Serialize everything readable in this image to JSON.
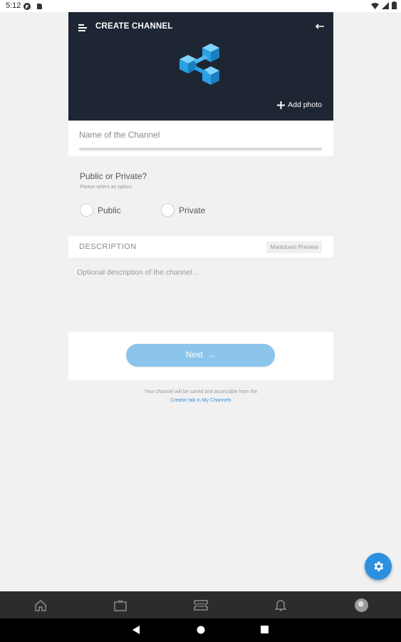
{
  "status_bar": {
    "time": "5:12"
  },
  "header": {
    "title": "CREATE CHANNEL",
    "add_photo_label": "Add photo"
  },
  "name_field": {
    "placeholder": "Name of the Channel",
    "value": ""
  },
  "privacy": {
    "title": "Public or Private?",
    "hint": "Please select an option.",
    "options": [
      "Public",
      "Private"
    ],
    "selected": null
  },
  "description": {
    "label": "DESCRIPTION",
    "markdown_preview_label": "Markdown Preview",
    "placeholder": "Optional description of the channel..."
  },
  "next_button": {
    "label": "Next",
    "arrow": "→"
  },
  "footer": {
    "note": "Your channel will be saved and accessible from the",
    "link": "Creator tab in My Channels"
  },
  "bottom_nav": {
    "items": [
      "home-icon",
      "tv-icon",
      "ticket-icon",
      "bell-icon",
      "avatar"
    ]
  },
  "system_nav": [
    "back-icon",
    "home-icon",
    "recents-icon"
  ],
  "colors": {
    "header_bg": "#1e2533",
    "accent": "#2b90e0",
    "next_button_bg": "#8cc5ec",
    "link": "#3a8fd8"
  }
}
